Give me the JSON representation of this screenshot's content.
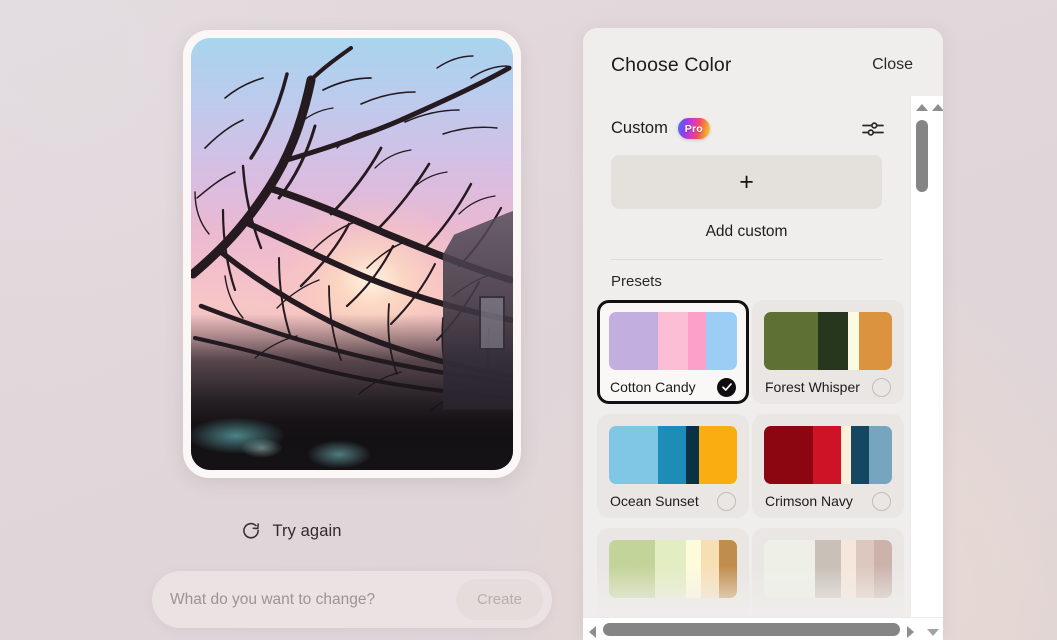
{
  "background_color": "#e1d7da",
  "preview": {
    "image_alt": "sunset-photo-bare-tree-branches",
    "try_again_label": "Try again",
    "try_again_icon": "refresh-icon",
    "prompt": {
      "placeholder": "What do you want to change?",
      "value": "",
      "create_label": "Create",
      "create_enabled": false
    }
  },
  "panel": {
    "title": "Choose Color",
    "close_label": "Close",
    "custom": {
      "label": "Custom",
      "badge": "Pro",
      "badge_gradient": "#3d7bf5,#8a3df0,#d339c4,#ef4a6a,#f58d33,#f2d63c",
      "settings_icon": "sliders-icon",
      "add_tile_icon": "plus-icon",
      "add_caption": "Add custom"
    },
    "presets_heading": "Presets",
    "presets": [
      {
        "name": "Cotton Candy",
        "selected": true,
        "colors": [
          "#c3aee0",
          "#fbbed4",
          "#fc9fc9",
          "#9ccdf5"
        ],
        "weights": [
          38,
          24,
          14,
          24
        ]
      },
      {
        "name": "Forest Whisper",
        "selected": false,
        "colors": [
          "#5f7034",
          "#26371d",
          "#fbfbe3",
          "#dc933f"
        ],
        "weights": [
          42,
          24,
          8,
          26
        ]
      },
      {
        "name": "Ocean Sunset",
        "selected": false,
        "colors": [
          "#7fc7e5",
          "#1d8cb6",
          "#0a3247",
          "#f9ad11"
        ],
        "weights": [
          38,
          22,
          10,
          30
        ]
      },
      {
        "name": "Crimson Navy",
        "selected": false,
        "colors": [
          "#8c0611",
          "#cf1327",
          "#fdf0d9",
          "#144761",
          "#76a5c0"
        ],
        "weights": [
          38,
          22,
          8,
          14,
          18
        ]
      },
      {
        "name": "",
        "selected": false,
        "colors": [
          "#c3d49a",
          "#e3edc2",
          "#fdfbd9",
          "#f7dfb4",
          "#c08d4c"
        ],
        "weights": [
          36,
          24,
          12,
          14,
          14
        ]
      },
      {
        "name": "",
        "selected": false,
        "colors": [
          "#eef0e8",
          "#c9c0b8",
          "#f7e6dc",
          "#ddc8bf",
          "#cbb3ac"
        ],
        "weights": [
          40,
          20,
          12,
          14,
          14
        ]
      }
    ],
    "scroll": {
      "vertical_up_icon": "caret-up-icon",
      "vertical_down_icon": "caret-down-icon",
      "horizontal_left_icon": "caret-left-icon",
      "horizontal_right_icon": "caret-right-icon"
    }
  }
}
